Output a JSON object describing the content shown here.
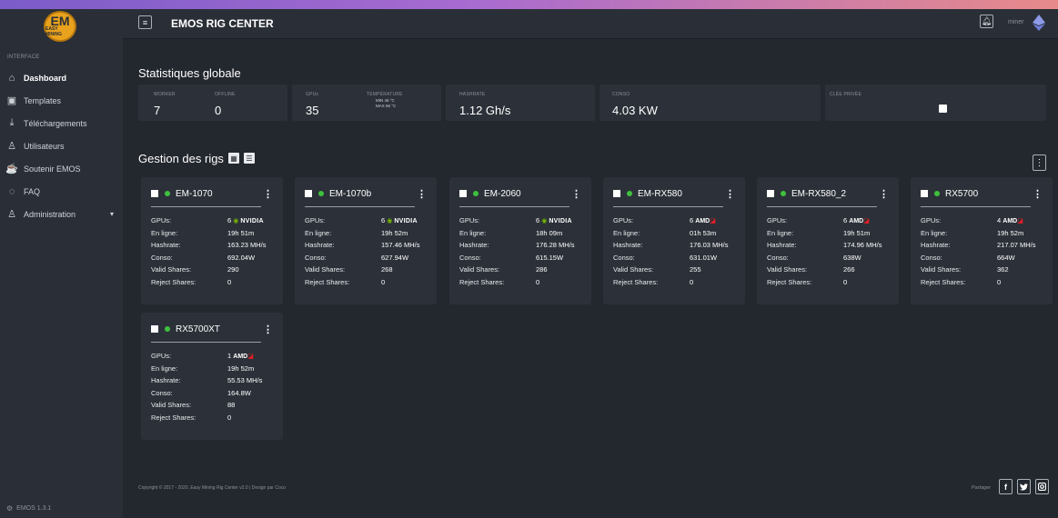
{
  "sidebar": {
    "logo_text": "EM",
    "logo_sub": "EASY MINING",
    "section_label": "INTERFACE",
    "items": [
      {
        "label": "Dashboard",
        "icon": "home-icon"
      },
      {
        "label": "Templates",
        "icon": "template-icon"
      },
      {
        "label": "Téléchargements",
        "icon": "download-icon"
      },
      {
        "label": "Utilisateurs",
        "icon": "user-icon"
      },
      {
        "label": "Soutenir EMOS",
        "icon": "support-icon"
      },
      {
        "label": "FAQ",
        "icon": "chat-icon"
      },
      {
        "label": "Administration",
        "icon": "admin-icon"
      }
    ],
    "version": "EMOS 1.3.1"
  },
  "header": {
    "title": "EMOS RIG CENTER",
    "user": "miner"
  },
  "stats": {
    "title": "Statistiques globale",
    "worker_label": "WORKER",
    "worker_value": "7",
    "offline_label": "OFFLINE",
    "offline_value": "0",
    "gpus_label": "GPUs",
    "gpus_value": "35",
    "temp_label": "TEMPÉRATURE",
    "temp_min": "MIN 46 °C",
    "temp_max": "MAX 66 °C",
    "hashrate_label": "HASHRATE",
    "hashrate_value": "1.12 Gh/s",
    "conso_label": "CONSO",
    "conso_value": "4.03 KW",
    "key_label": "CLÉE PRIVÉE"
  },
  "rigs_section": {
    "title": "Gestion des rigs"
  },
  "row_labels": {
    "gpus": "GPUs:",
    "online": "En ligne:",
    "hashrate": "Hashrate:",
    "conso": "Conso:",
    "valid": "Valid Shares:",
    "reject": "Reject Shares:"
  },
  "rigs": [
    {
      "name": "EM-1070",
      "gpu_count": "6",
      "brand": "NVIDIA",
      "online": "19h 51m",
      "hashrate": "163.23 MH/s",
      "conso": "692.04W",
      "valid": "290",
      "reject": "0"
    },
    {
      "name": "EM-1070b",
      "gpu_count": "6",
      "brand": "NVIDIA",
      "online": "19h 52m",
      "hashrate": "157.46 MH/s",
      "conso": "627.94W",
      "valid": "268",
      "reject": "0"
    },
    {
      "name": "EM-2060",
      "gpu_count": "6",
      "brand": "NVIDIA",
      "online": "18h 09m",
      "hashrate": "176.28 MH/s",
      "conso": "615.15W",
      "valid": "286",
      "reject": "0"
    },
    {
      "name": "EM-RX580",
      "gpu_count": "6",
      "brand": "AMD",
      "online": "01h 53m",
      "hashrate": "176.03 MH/s",
      "conso": "631.01W",
      "valid": "255",
      "reject": "0"
    },
    {
      "name": "EM-RX580_2",
      "gpu_count": "6",
      "brand": "AMD",
      "online": "19h 51m",
      "hashrate": "174.96 MH/s",
      "conso": "638W",
      "valid": "266",
      "reject": "0"
    },
    {
      "name": "RX5700",
      "gpu_count": "4",
      "brand": "AMD",
      "online": "19h 52m",
      "hashrate": "217.07 MH/s",
      "conso": "664W",
      "valid": "362",
      "reject": "0"
    },
    {
      "name": "RX5700XT",
      "gpu_count": "1",
      "brand": "AMD",
      "online": "19h 52m",
      "hashrate": "55.53 MH/s",
      "conso": "164.8W",
      "valid": "88",
      "reject": "0"
    }
  ],
  "footer": {
    "copyright": "Copyright © 2017 - 2020, Easy Mining Rig Center v2.0 | Design par Coco",
    "share_label": "Partager",
    "social": [
      "f",
      "t",
      "i"
    ]
  },
  "colors": {
    "online_dot": "#3ec13e",
    "nvidia_green": "#76b900",
    "amd_red": "#ed1c24",
    "logo_orange": "#e8a21d"
  }
}
